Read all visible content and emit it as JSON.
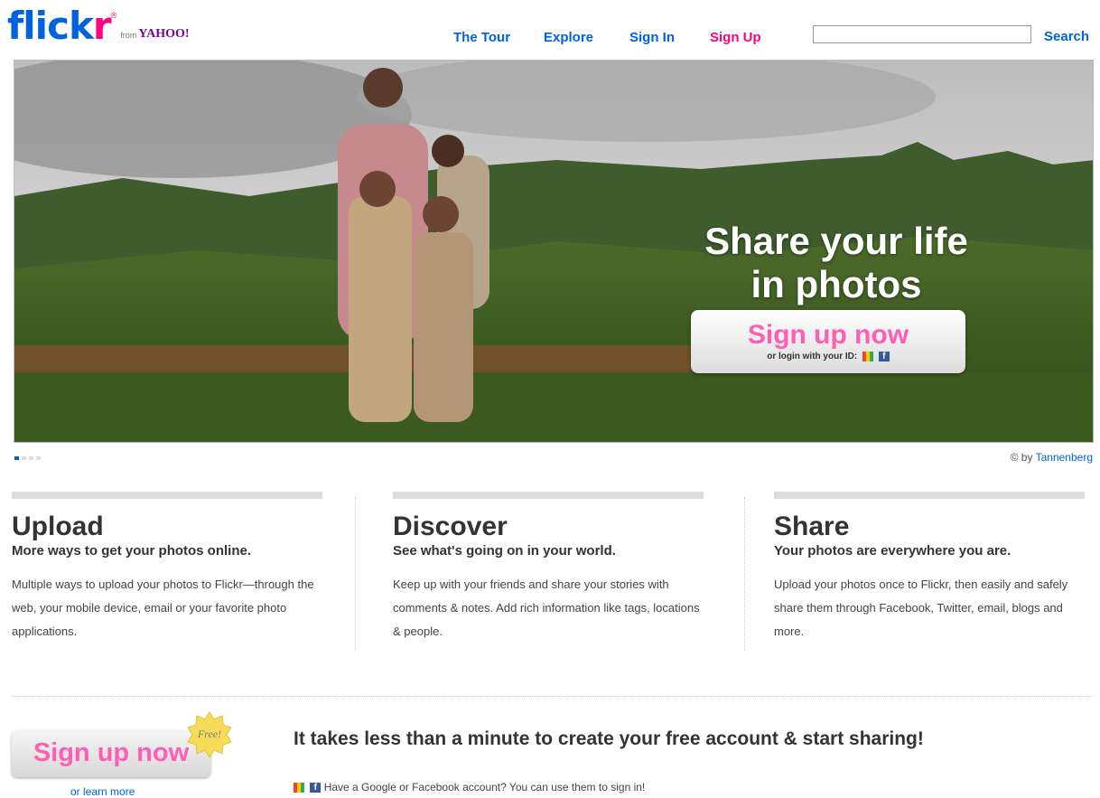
{
  "logo": {
    "main": "flick",
    "accent": "r",
    "reg": "®",
    "from": "from",
    "yahoo": "YAHOO!"
  },
  "nav": {
    "tour": "The Tour",
    "explore": "Explore",
    "sign_in": "Sign In",
    "sign_up": "Sign Up"
  },
  "search": {
    "value": "",
    "button": "Search"
  },
  "hero": {
    "headline_line1": "Share your life",
    "headline_line2": "in photos",
    "cta_label": "Sign up now",
    "cta_sub": "or login with your ID:",
    "photo_credit_prefix": "© by",
    "photo_credit_name": "Tannenberg",
    "slide_count": 4,
    "active_slide": 1
  },
  "columns": [
    {
      "title": "Upload",
      "subtitle": "More ways to get your photos online.",
      "body": "Multiple ways to upload your photos to Flickr—through the web, your mobile device, email or your favorite photo applications."
    },
    {
      "title": "Discover",
      "subtitle": "See what's going on in your world.",
      "body": "Keep up with your friends and share your stories with comments & notes. Add rich information like tags, locations & people."
    },
    {
      "title": "Share",
      "subtitle": "Your photos are everywhere you are.",
      "body": "Upload your photos once to Flickr, then easily and safely share them through Facebook, Twitter, email, blogs and more."
    }
  ],
  "bottom": {
    "cta_label": "Sign up now",
    "badge": "Free!",
    "learn_more": "or learn more",
    "headline": "It takes less than a minute to create your free account & start sharing!",
    "sub": "Have a Google or Facebook account? You can use them to sign in!"
  },
  "colors": {
    "brand_blue": "#0063dc",
    "brand_pink": "#ff0084"
  }
}
